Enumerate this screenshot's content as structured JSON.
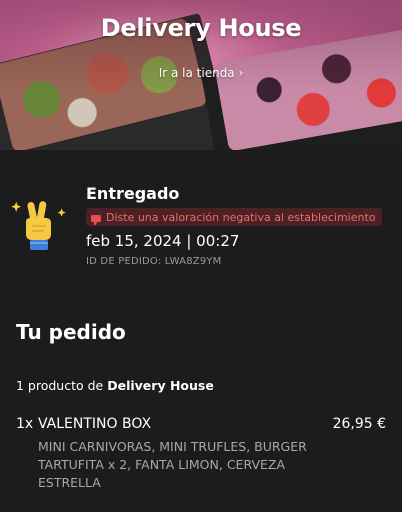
{
  "store": {
    "name": "Delivery House",
    "link_label": "Ir a la tienda ›"
  },
  "order": {
    "status": "Entregado",
    "rating_badge": "Diste una valoración negativa al establecimiento",
    "datetime": "feb 15, 2024 | 00:27",
    "order_id": "ID DE PEDIDO: LWA8Z9YM"
  },
  "summary": {
    "title": "Tu pedido",
    "count_prefix": "1 producto de ",
    "count_store": "Delivery House"
  },
  "items": [
    {
      "qty": "1x",
      "name": "VALENTINO BOX",
      "price": "26,95 €",
      "description": "MINI CARNIVORAS, MINI TRUFLES, BURGER TARTUFITA x 2, FANTA LIMON, CERVEZA ESTRELLA"
    }
  ],
  "colors": {
    "background": "#1c1c1c",
    "badge_bg": "#4a2226",
    "badge_text": "#f06a6a",
    "muted_text": "#a8a8a8"
  },
  "icons": {
    "medal": "victory-hand-icon",
    "badge": "thumbs-down-icon"
  }
}
